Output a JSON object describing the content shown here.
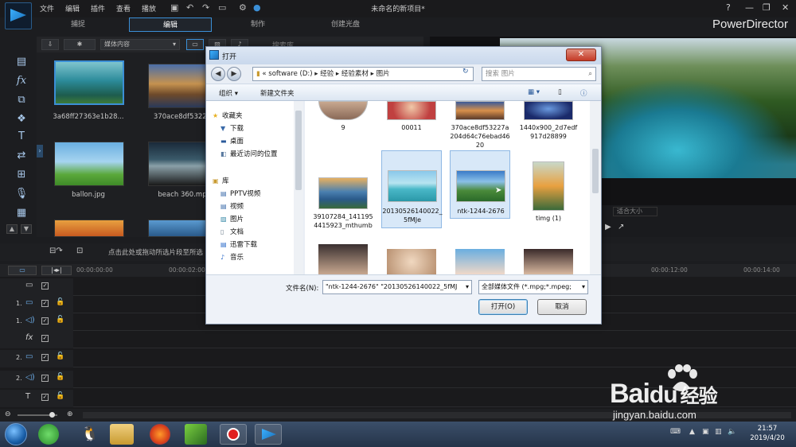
{
  "app": {
    "window_title": "未命名的新项目*",
    "brand": "PowerDirector",
    "menu": [
      "文件",
      "编辑",
      "插件",
      "查看",
      "播放"
    ],
    "mode_tabs": [
      "捕捉",
      "编辑",
      "制作",
      "创建光盘"
    ],
    "active_mode": "编辑"
  },
  "library": {
    "dropdown": "媒体内容",
    "search_placeholder": "搜索库",
    "items": [
      {
        "name": "3a68ff27363e1b28...",
        "selected": true
      },
      {
        "name": "370ace8df53227"
      },
      {
        "name": "ballon.jpg"
      },
      {
        "name": "beach 360.mp"
      }
    ],
    "hint": "点击此处或拖动所选片段至所选"
  },
  "preview": {
    "fit_label": "适合大小"
  },
  "timeline": {
    "timecodes": [
      "00:00:00:00",
      "00:00:02:00",
      "00:00:12:00",
      "00:00:14:00"
    ],
    "tracks": [
      {
        "num": "",
        "icon": "video-track-icon"
      },
      {
        "num": "1.",
        "icon": "video-track-icon"
      },
      {
        "num": "1.",
        "icon": "audio-track-icon"
      },
      {
        "num": "",
        "icon": "fx-track-icon"
      },
      {
        "num": "2.",
        "icon": "video-track-icon"
      },
      {
        "num": "2.",
        "icon": "audio-track-icon"
      },
      {
        "num": "",
        "icon": "title-track-icon"
      }
    ]
  },
  "dialog": {
    "title": "打开",
    "address": [
      "software (D:)",
      "经验",
      "经验素材",
      "图片"
    ],
    "address_prefix": "«",
    "search_placeholder": "搜索 图片",
    "organize": "组织 ▾",
    "new_folder": "新建文件夹",
    "nav": {
      "favorites": "收藏夹",
      "fav_items": [
        "下载",
        "桌面",
        "最近访问的位置"
      ],
      "libraries": "库",
      "lib_items": [
        "PPTV视频",
        "视频",
        "图片",
        "文档",
        "迅雷下载",
        "音乐"
      ]
    },
    "files": [
      {
        "name": "9"
      },
      {
        "name": "00011"
      },
      {
        "name": "370ace8df53227a204d64c76ebad4620"
      },
      {
        "name": "1440x900_2d7edf917d28899"
      },
      {
        "name": "39107284_1411954415923_mthumb"
      },
      {
        "name": "20130526140022_5fMJe",
        "selected": true
      },
      {
        "name": "ntk-1244-2676",
        "selected": true
      },
      {
        "name": "timg (1)"
      }
    ],
    "filename_label": "文件名(N):",
    "filename_value": "\"ntk-1244-2676\" \"20130526140022_5fMJ",
    "filetype_value": "全部媒体文件 (*.mpg;*.mpeg;",
    "open_button": "打开(O)",
    "cancel_button": "取消"
  },
  "taskbar": {
    "time": "21:57",
    "date": "2019/4/20"
  },
  "watermark": {
    "brand": "Bai",
    "brand_tail": "du",
    "cn": "经验",
    "url": "jingyan.baidu.com"
  }
}
